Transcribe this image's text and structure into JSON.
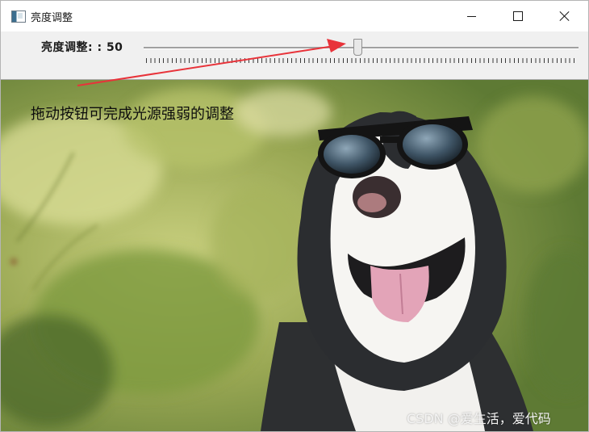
{
  "window": {
    "title": "亮度调整"
  },
  "trackbar": {
    "label": "亮度调整: : 50",
    "value": 50,
    "min": 0,
    "max": 100
  },
  "image": {
    "caption": "拖动按钮可完成光源强弱的调整",
    "watermark": "CSDN @爱生活，爱代码"
  },
  "colors": {
    "arrow": "#e8333a",
    "panel": "#f0f0f0"
  },
  "icons": {
    "app": "window-app-icon",
    "minimize": "minimize-icon",
    "maximize": "maximize-icon",
    "close": "close-icon"
  }
}
